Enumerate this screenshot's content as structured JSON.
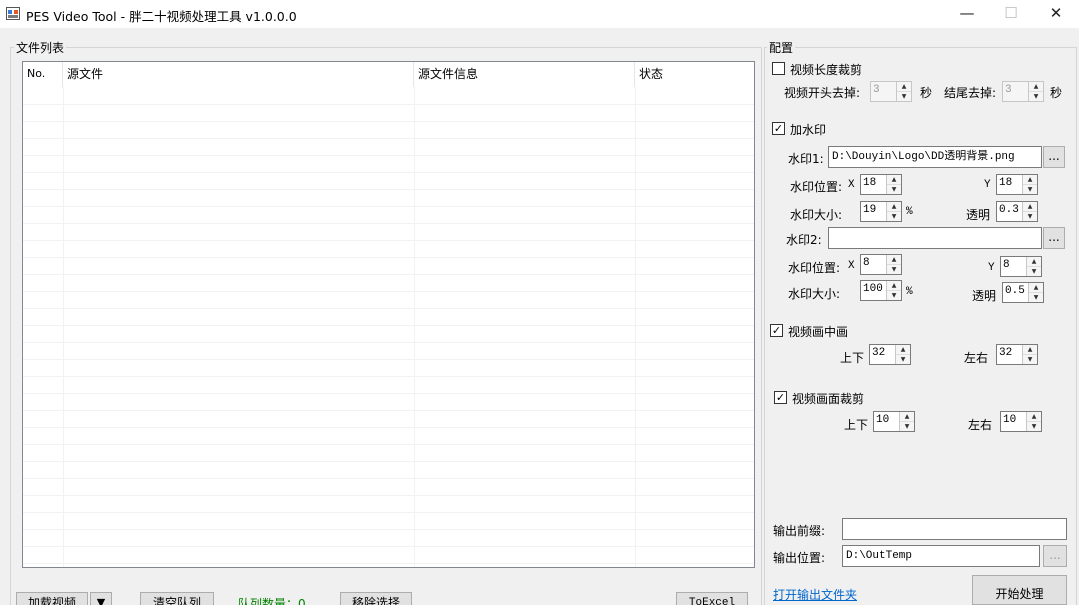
{
  "window": {
    "title": "PES Video Tool - 胖二十视频处理工具 v1.0.0.0",
    "controls": {
      "minimize": "—",
      "maximize": "☐",
      "close": "✕"
    }
  },
  "file_list": {
    "group_title": "文件列表",
    "columns": [
      "No.",
      "源文件",
      "源文件信息",
      "状态"
    ],
    "rows": []
  },
  "bottom_bar": {
    "load_video": "加载视频",
    "dropdown_arrow": "▼",
    "clear_queue": "清空队列",
    "queue_count": "队列数量：0",
    "remove_selected": "移除选择",
    "to_excel": "ToExcel"
  },
  "config": {
    "group_title": "配置",
    "trim": {
      "label": "视频长度裁剪",
      "checked": false,
      "head_label": "视频开头去掉:",
      "head_value": "3",
      "head_unit": "秒",
      "tail_label": "结尾去掉:",
      "tail_value": "3",
      "tail_unit": "秒"
    },
    "watermark": {
      "label": "加水印",
      "checked": true,
      "wm1_label": "水印1:",
      "wm1_path": "D:\\Douyin\\Logo\\DD透明背景.png",
      "browse": "...",
      "wm1_pos_label": "水印位置:",
      "wm1_x_label": "X",
      "wm1_x": "18",
      "wm1_y_label": "Y",
      "wm1_y": "18",
      "wm1_size_label": "水印大小:",
      "wm1_size": "19",
      "wm1_size_unit": "%",
      "wm1_opacity_label": "透明",
      "wm1_opacity": "0.3",
      "wm2_label": "水印2:",
      "wm2_path": "",
      "wm2_pos_label": "水印位置:",
      "wm2_x_label": "X",
      "wm2_x": "8",
      "wm2_y_label": "Y",
      "wm2_y": "8",
      "wm2_size_label": "水印大小:",
      "wm2_size": "100",
      "wm2_size_unit": "%",
      "wm2_opacity_label": "透明",
      "wm2_opacity": "0.5"
    },
    "pip": {
      "label": "视频画中画",
      "checked": true,
      "vert_label": "上下",
      "vert_value": "32",
      "horiz_label": "左右",
      "horiz_value": "32"
    },
    "crop": {
      "label": "视频画面裁剪",
      "checked": true,
      "vert_label": "上下",
      "vert_value": "10",
      "horiz_label": "左右",
      "horiz_value": "10"
    },
    "output": {
      "prefix_label": "输出前缀:",
      "prefix_value": "",
      "location_label": "输出位置:",
      "location_value": "D:\\OutTemp",
      "browse": "...",
      "open_folder": "打开输出文件夹",
      "start": "开始处理"
    }
  },
  "icons": {
    "check": "✓",
    "spin_up": "▲",
    "spin_down": "▼"
  }
}
